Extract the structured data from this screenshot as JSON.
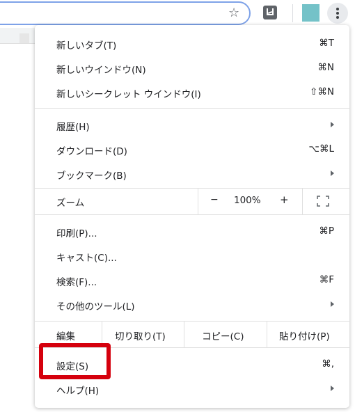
{
  "toolbar": {
    "star_icon": "star-icon",
    "extension_icon": "extension-icon",
    "profile_color": "#74c2c8",
    "menu_icon": "kebab-menu-icon"
  },
  "menu": {
    "new_tab": {
      "label": "新しいタブ(T)",
      "shortcut": "⌘T"
    },
    "new_window": {
      "label": "新しいウインドウ(N)",
      "shortcut": "⌘N"
    },
    "incognito": {
      "label": "新しいシークレット ウインドウ(I)",
      "shortcut": "⇧⌘N"
    },
    "history": {
      "label": "履歴(H)"
    },
    "downloads": {
      "label": "ダウンロード(D)",
      "shortcut": "⌥⌘L"
    },
    "bookmarks": {
      "label": "ブックマーク(B)"
    },
    "zoom": {
      "label": "ズーム",
      "minus": "−",
      "level": "100%",
      "plus": "+"
    },
    "print": {
      "label": "印刷(P)...",
      "shortcut": "⌘P"
    },
    "cast": {
      "label": "キャスト(C)..."
    },
    "find": {
      "label": "検索(F)...",
      "shortcut": "⌘F"
    },
    "more_tools": {
      "label": "その他のツール(L)"
    },
    "edit": {
      "label": "編集",
      "cut": "切り取り(T)",
      "copy": "コピー(C)",
      "paste": "貼り付け(P)"
    },
    "settings": {
      "label": "設定(S)",
      "shortcut": "⌘,"
    },
    "help": {
      "label": "ヘルプ(H)"
    }
  },
  "colors": {
    "highlight": "#d5000d",
    "accent": "#7ea2e8"
  }
}
